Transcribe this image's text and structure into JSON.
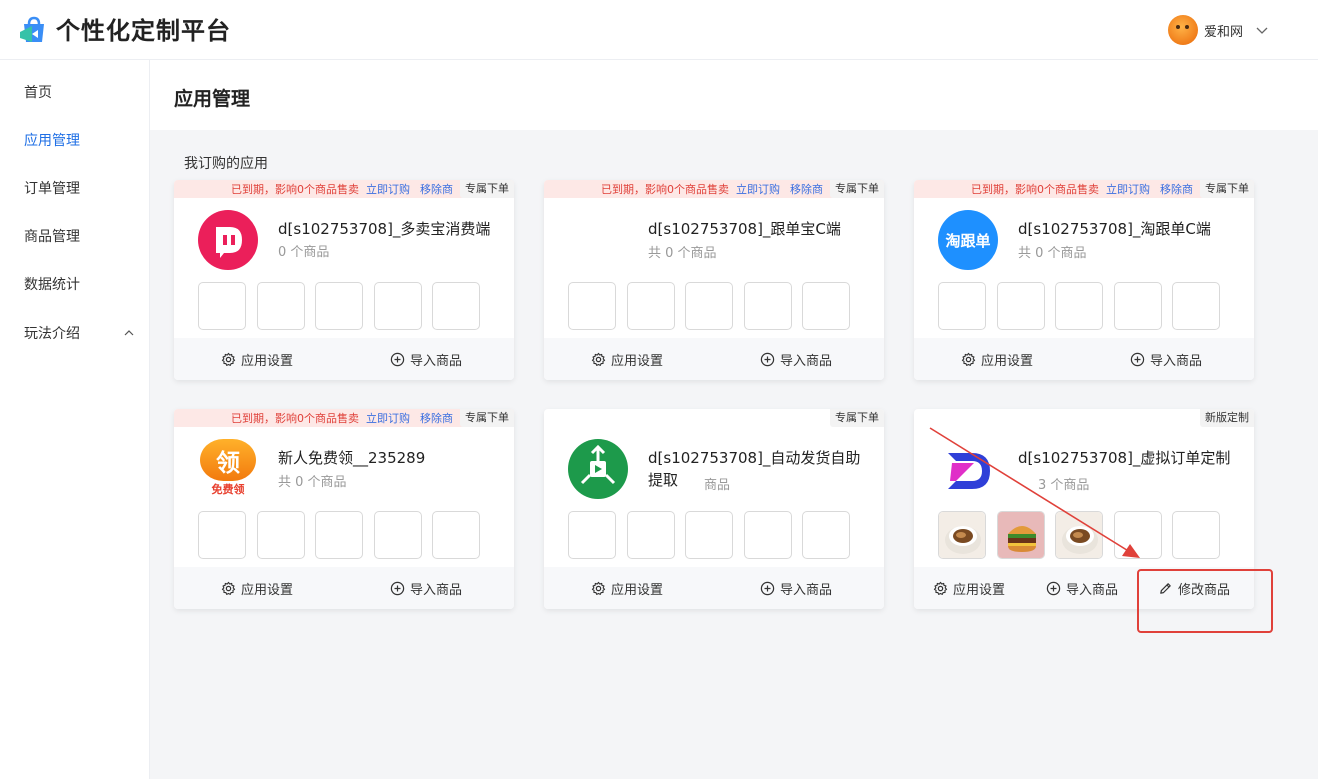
{
  "app": {
    "title": "个性化定制平台"
  },
  "user": {
    "name": "爱和网"
  },
  "sidebar": {
    "items": [
      {
        "label": "首页"
      },
      {
        "label": "应用管理"
      },
      {
        "label": "订单管理"
      },
      {
        "label": "商品管理"
      },
      {
        "label": "数据统计"
      },
      {
        "label": "玩法介绍"
      }
    ]
  },
  "page": {
    "title": "应用管理",
    "section_title": "我订购的应用"
  },
  "warning": {
    "text": "已到期，影响0个商品售卖",
    "subscribe": "立即订购",
    "remove": "移除商"
  },
  "actions": {
    "settings": "应用设置",
    "import": "导入商品",
    "edit": "修改商品"
  },
  "cards": [
    {
      "tag": "专属下单",
      "name": "d[s102753708]_多卖宝消费端",
      "count": "0 个商品",
      "icon": "duomaibao-logo"
    },
    {
      "tag": "专属下单",
      "name": "d[s102753708]_跟单宝C端",
      "count": "共 0 个商品",
      "icon": "none"
    },
    {
      "tag": "专属下单",
      "name": "d[s102753708]_淘跟单C端",
      "count": "共 0 个商品",
      "icon": "taogendan-logo",
      "icon_text": "淘跟单"
    },
    {
      "tag": "专属下单",
      "name": "新人免费领__235289",
      "count": "共 0 个商品",
      "icon": "mianfeiling-logo",
      "icon_text": "领",
      "icon_subtext": "免费领"
    },
    {
      "tag": "专属下单",
      "name": "d[s102753708]_自动发货自助提取",
      "count": "商品",
      "icon": "auto-delivery-logo"
    },
    {
      "tag": "新版定制",
      "name": "d[s102753708]_虚拟订单定制",
      "count": "3 个商品",
      "icon": "virtual-order-logo"
    }
  ],
  "colors": {
    "accent": "#1f6fe5",
    "warning": "#e0413a",
    "link": "#3b6fe0"
  }
}
